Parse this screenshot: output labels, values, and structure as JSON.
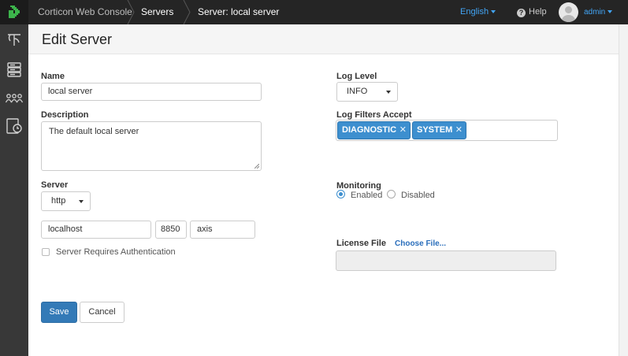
{
  "topbar": {
    "app_name": "Corticon Web Console",
    "breadcrumbs": [
      "Servers",
      "Server: local server"
    ],
    "language": "English",
    "help_label": "Help",
    "user": "admin"
  },
  "sidebar": {
    "icons": [
      "deploy-icon",
      "servers-icon",
      "users-icon",
      "monitor-icon"
    ]
  },
  "page": {
    "title": "Edit Server"
  },
  "form": {
    "name_label": "Name",
    "name_value": "local server",
    "description_label": "Description",
    "description_value": "The default local server",
    "server_label": "Server",
    "protocol": "http",
    "host": "localhost",
    "port": "8850",
    "path": "axis",
    "auth_label": "Server Requires Authentication",
    "auth_checked": false,
    "log_level_label": "Log Level",
    "log_level": "INFO",
    "log_filters_label": "Log Filters Accept",
    "log_filters": [
      "DIAGNOSTIC",
      "SYSTEM"
    ],
    "monitoring_label": "Monitoring",
    "monitoring_options": [
      "Enabled",
      "Disabled"
    ],
    "monitoring_selected": "Enabled",
    "license_label": "License File",
    "choose_file_label": "Choose File..."
  },
  "buttons": {
    "save": "Save",
    "cancel": "Cancel"
  },
  "colors": {
    "accent": "#3d8fcf",
    "primary_button": "#337ab7",
    "logo_green": "#3cb44b",
    "topbar": "#252525",
    "sidebar": "#383838"
  }
}
